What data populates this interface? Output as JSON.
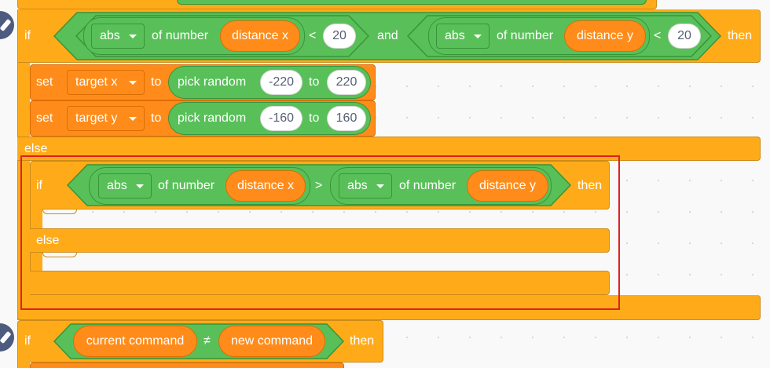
{
  "if_label": "if",
  "then_label": "then",
  "else_label": "else",
  "and_label": "and",
  "set_label": "set",
  "to_label": "to",
  "of_number_label": "of number",
  "pick_random_label": "pick random",
  "op_less": "<",
  "op_greater": ">",
  "op_not_equal": "≠",
  "func_abs": "abs",
  "var_distance_x": "distance x",
  "var_distance_y": "distance y",
  "var_target_x": "target x",
  "var_target_y": "target y",
  "var_current_command": "current command",
  "var_new_command": "new command",
  "threshold_x": "20",
  "threshold_y": "20",
  "random_x_min": "-220",
  "random_x_max": "220",
  "random_y_min": "-160",
  "random_y_max": "160",
  "colors": {
    "control": "#ffab19",
    "data": "#ff8c1a",
    "operators": "#59c059",
    "highlight": "#e02020"
  }
}
